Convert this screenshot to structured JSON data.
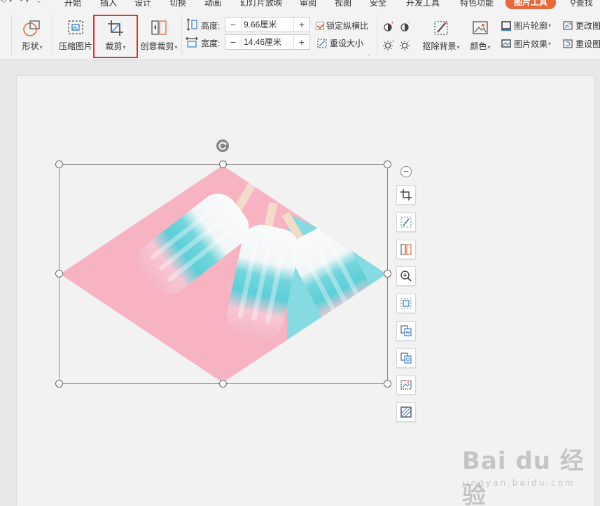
{
  "tabs": [
    "开始",
    "插入",
    "设计",
    "切换",
    "动画",
    "幻灯片放映",
    "审阅",
    "视图",
    "安全",
    "开发工具",
    "特色功能",
    "图片工具"
  ],
  "active_tab": "图片工具",
  "search_label": "查找",
  "ribbon": {
    "shape_label": "形状",
    "compress_label": "压缩图片",
    "crop_label": "裁剪",
    "creative_crop_label": "创意裁剪",
    "height_label": "高度:",
    "height_value": "9.66厘米",
    "width_label": "宽度:",
    "width_value": "14.46厘米",
    "lock_ratio_label": "锁定纵横比",
    "reset_size_label": "重设大小",
    "remove_bg_label": "抠除背景",
    "color_label": "颜色",
    "outline_label": "图片轮廓",
    "effects_label": "图片效果",
    "change_image_label": "更改图",
    "reset_image_label": "重设图"
  },
  "watermark": {
    "main": "Bai du 经验",
    "sub": "jingyan.baidu.com"
  },
  "colors": {
    "accent": "#e8693c",
    "highlight": "#e03030",
    "pink": "#f7b3c2",
    "cyan": "#86dbe2"
  }
}
